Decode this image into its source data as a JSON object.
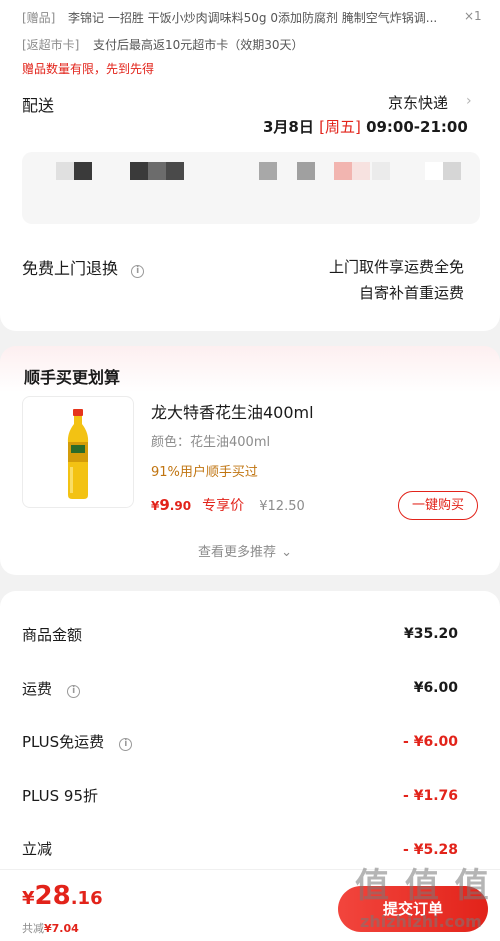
{
  "gift": {
    "tag": "[赠品]",
    "text": "李锦记 一招胜 干饭小炒肉调味料50g 0添加防腐剂 腌制空气炸锅调...",
    "qty": "×1"
  },
  "rebate": {
    "tag": "[返超市卡]",
    "text": "支付后最高返10元超市卡（效期30天）"
  },
  "gift_notice": "赠品数量有限，先到先得",
  "delivery": {
    "label": "配送",
    "carrier": "京东快递",
    "date": "3月8日",
    "weekday": "[周五]",
    "time": "09:00-21:00"
  },
  "return_service": {
    "label": "免费上门退换",
    "line1": "上门取件享运费全免",
    "line2": "自寄补首重运费"
  },
  "recommend": {
    "title": "顺手买更划算",
    "product": {
      "name": "龙大特香花生油400ml",
      "spec": "颜色：花生油400ml",
      "buy_rate": "91%用户顺手买过",
      "price_symbol": "¥",
      "price_int": "9",
      "price_dec": ".90",
      "price_tag": "专享价",
      "orig_price": "¥12.50",
      "buy_button": "一键购买"
    },
    "more": "查看更多推荐"
  },
  "summary": {
    "goods_label": "商品金额",
    "goods_value": "¥35.20",
    "freight_label": "运费",
    "freight_value": "¥6.00",
    "plus_free_label": "PLUS免运费",
    "plus_free_value": "- ¥6.00",
    "plus_discount_label": "PLUS 95折",
    "plus_discount_value": "- ¥1.76",
    "instant_label": "立减",
    "instant_value": "- ¥5.28"
  },
  "bottom": {
    "currency": "¥",
    "total_int": "28",
    "total_dec": ".16",
    "saved_label": "共减",
    "saved_value": "¥7.04",
    "submit": "提交订单"
  },
  "watermark": {
    "logo": "值 值 值",
    "site": "zhizhizhi.com"
  },
  "colors": {
    "accent": "#e2231a",
    "orange_text": "#c07410",
    "muted": "#8c8c8c"
  }
}
